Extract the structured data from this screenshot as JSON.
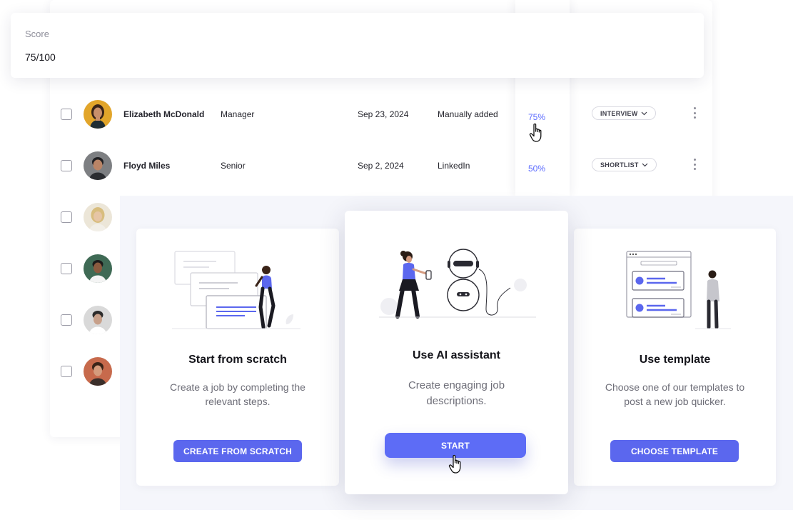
{
  "score_card": {
    "label": "Score",
    "value": "75/100"
  },
  "candidates": [
    {
      "name": "Elizabeth McDonald",
      "level": "Manager",
      "date": "Sep 23, 2024",
      "source": "Manually added",
      "score": "75%",
      "status": "INTERVIEW"
    },
    {
      "name": "Floyd Miles",
      "level": "Senior",
      "date": "Sep 2, 2024",
      "source": "LinkedIn",
      "score": "50%",
      "status": "SHORTLIST"
    }
  ],
  "options": {
    "scratch": {
      "title": "Start from scratch",
      "description": "Create a job by completing the relevant steps.",
      "button": "CREATE FROM SCRATCH"
    },
    "ai": {
      "title": "Use AI assistant",
      "description": "Create engaging job descriptions.",
      "button": "START"
    },
    "template": {
      "title": "Use template",
      "description": "Choose one of our templates to post a new job quicker.",
      "button": "CHOOSE TEMPLATE"
    }
  },
  "icons": {
    "status_dropdown": "chevron-down-icon",
    "row_menu": "more-vertical-icon",
    "pointer": "hand-pointer-icon"
  },
  "colors": {
    "accent": "#5b67ee",
    "score_text": "#5b6bff",
    "panel_background": "#f5f6fb"
  }
}
